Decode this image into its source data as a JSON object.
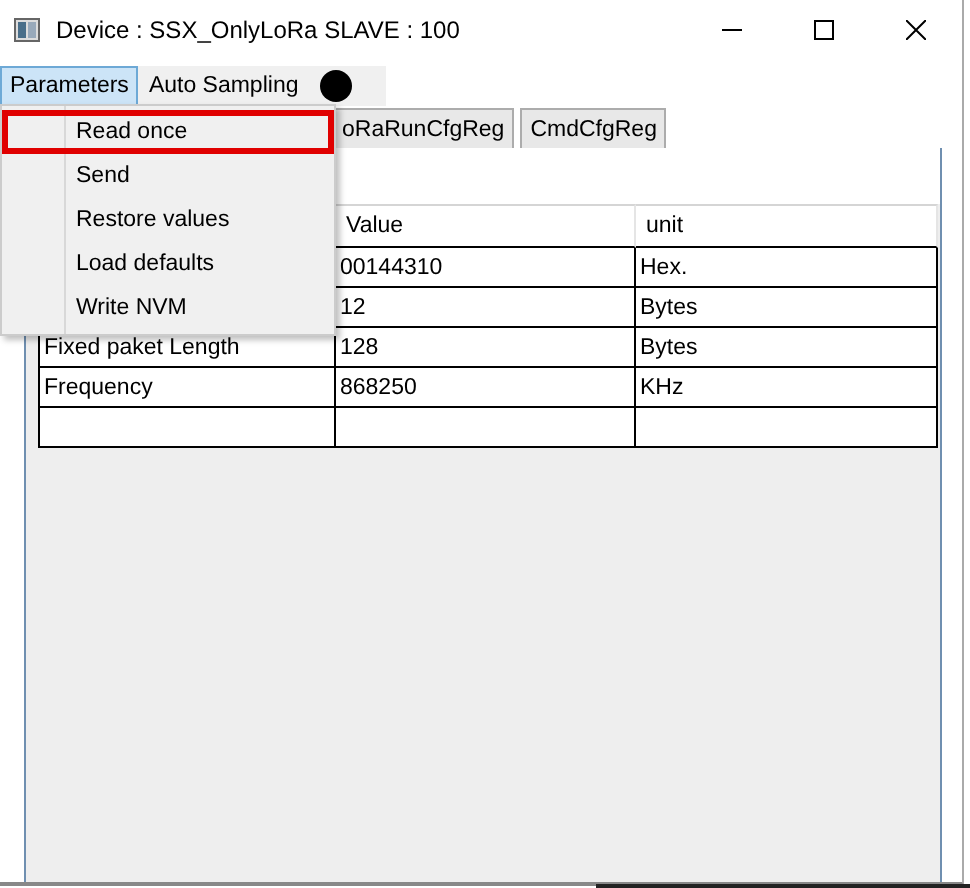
{
  "window": {
    "title": "Device : SSX_OnlyLoRa SLAVE : 100"
  },
  "menu_bar": [
    {
      "label": "Parameters",
      "selected": true
    },
    {
      "label": "Auto Sampling",
      "selected": false
    }
  ],
  "tabs": [
    {
      "label": "oRaRunCfgReg",
      "selected": false
    },
    {
      "label": "CmdCfgReg",
      "selected": false
    }
  ],
  "table": {
    "columns": [
      "Value",
      "unit"
    ],
    "rows": [
      {
        "value": "00144310",
        "unit": "Hex."
      },
      {
        "value": "12",
        "unit": "Bytes"
      },
      {
        "name": "Fixed paket Length",
        "value": "128",
        "unit": "Bytes"
      },
      {
        "name": "Frequency",
        "value": "868250",
        "unit": "KHz"
      }
    ]
  },
  "dropdown_menu": [
    {
      "label": "Read once",
      "selected": true
    },
    {
      "label": "Send",
      "selected": false
    },
    {
      "label": "Restore  values",
      "selected": false
    },
    {
      "label": "Load defaults",
      "selected": false
    },
    {
      "label": "Write NVM",
      "selected": false
    }
  ]
}
